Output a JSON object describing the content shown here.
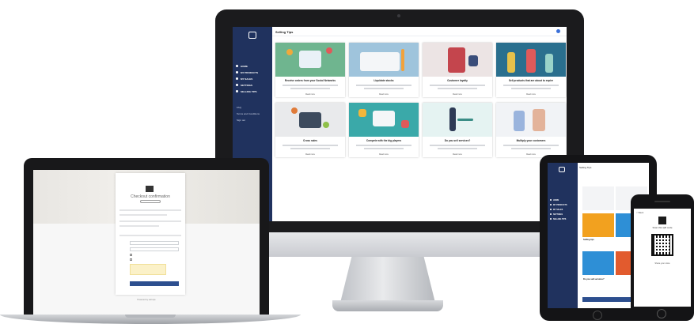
{
  "colors": {
    "sidebar": "#20325e",
    "accent": "#2d4f8f"
  },
  "imac": {
    "page_title": "Selling Tips",
    "nav": [
      "HOME",
      "MY PRODUCTS",
      "MY SALES",
      "SETTINGS",
      "SELLING TIPS"
    ],
    "links": [
      "FAQ",
      "Terms and Conditions",
      "Sign out"
    ],
    "cards": [
      {
        "title": "Receive orders from your Social Networks",
        "button": "Read more",
        "color": "#6fb58f"
      },
      {
        "title": "Liquidate stocks",
        "button": "Read more",
        "color": "#9fc4dc"
      },
      {
        "title": "Customer loyalty",
        "button": "Read more",
        "color": "#ece4e4"
      },
      {
        "title": "Sell products that are about to expire",
        "button": "Read more",
        "color": "#2a6f8e"
      },
      {
        "title": "Cross sales",
        "button": "Read more",
        "color": "#e9eaec"
      },
      {
        "title": "Compete with the big players",
        "button": "Read more",
        "color": "#3aa9a9"
      },
      {
        "title": "Do you sell services?",
        "button": "Read more",
        "color": "#e5f3f2"
      },
      {
        "title": "Multiply your customers",
        "button": "Read more",
        "color": "#f1f3f6"
      }
    ]
  },
  "laptop": {
    "heading": "Checkout confirmation",
    "footer": "Powered by sell-tips"
  },
  "tablet": {
    "header": "Selling Tips",
    "nav": [
      "HOME",
      "MY PRODUCTS",
      "MY SALES",
      "SETTINGS",
      "SELLING TIPS"
    ],
    "tile_labels": [
      "Selling tips",
      "Do you sell services?"
    ]
  },
  "phone": {
    "back": "< Back",
    "heading": "Scan this QR code",
    "caption": "Share your store"
  }
}
